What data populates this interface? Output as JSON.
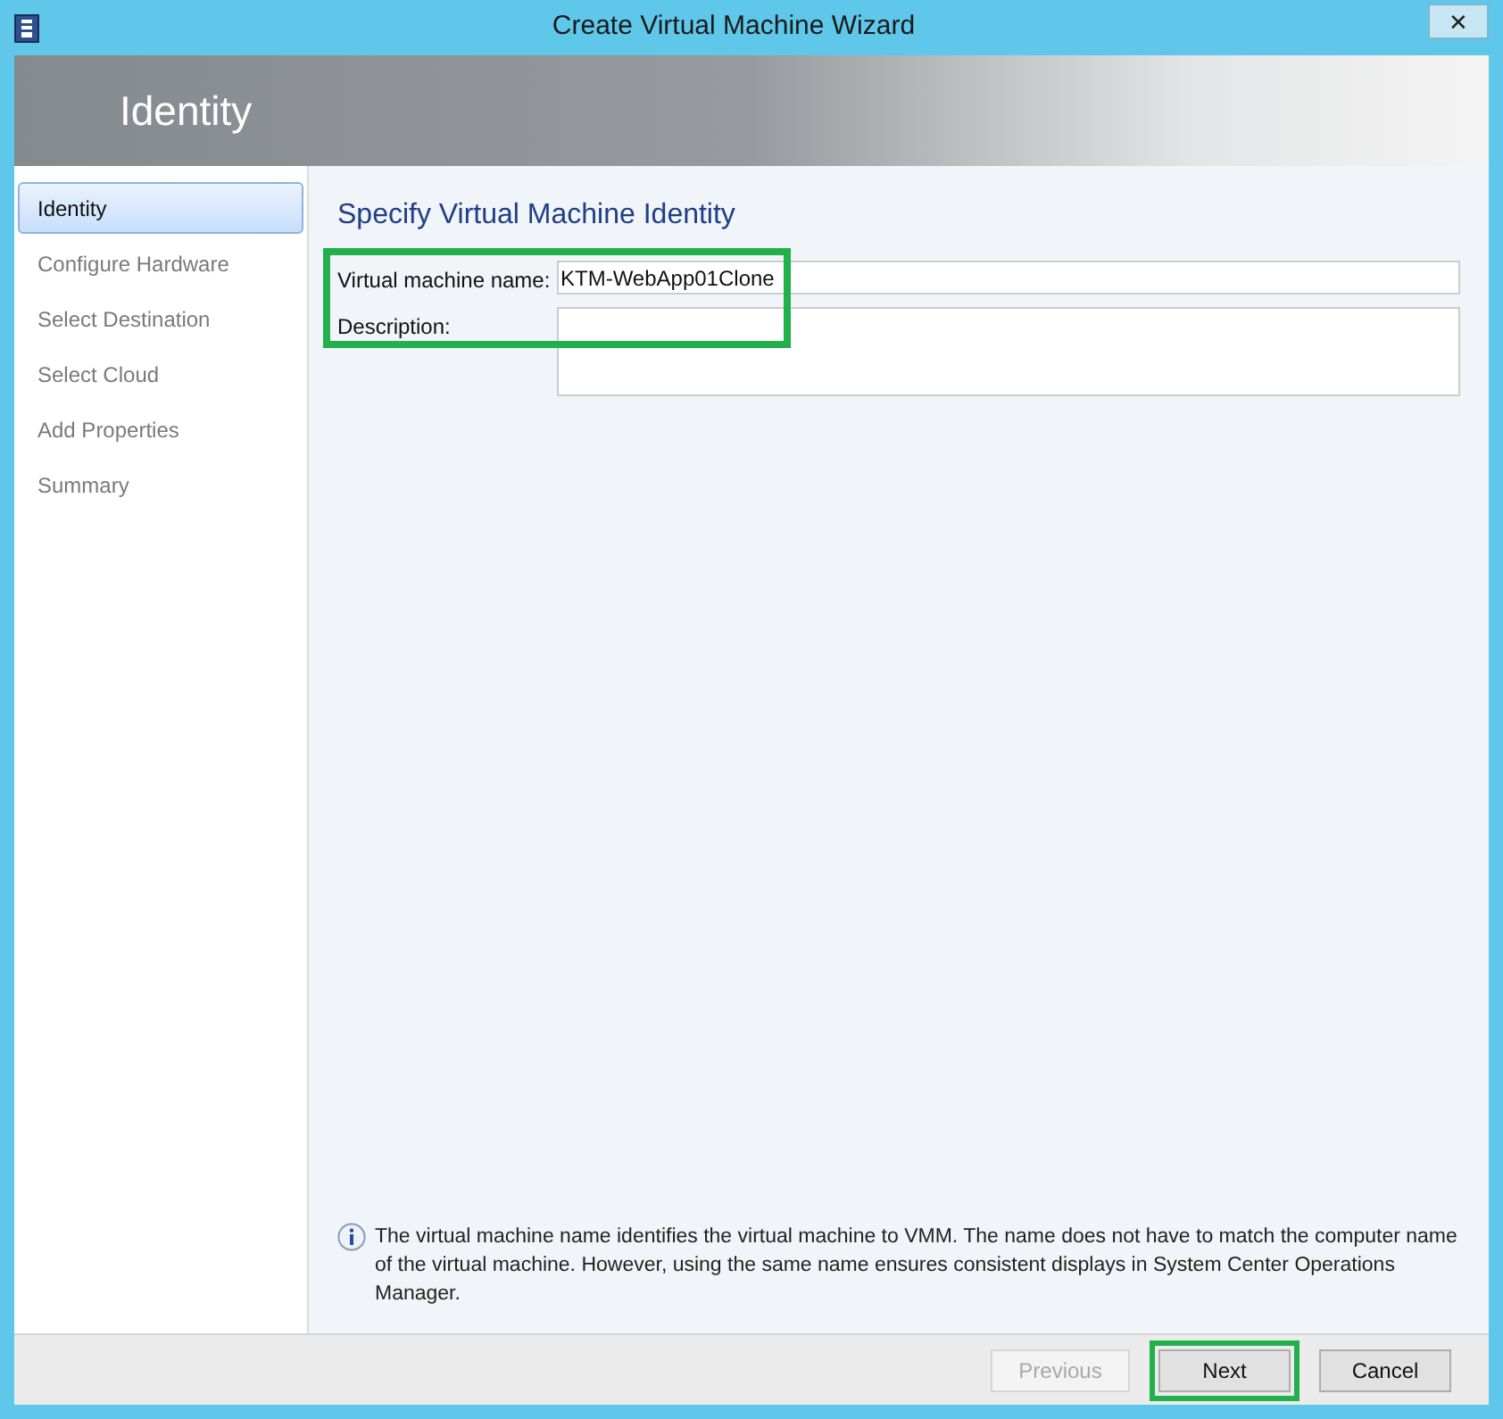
{
  "window": {
    "title": "Create Virtual Machine Wizard",
    "close": "✕"
  },
  "header": {
    "title": "Identity"
  },
  "sidebar": {
    "items": [
      {
        "label": "Identity",
        "selected": true
      },
      {
        "label": "Configure Hardware",
        "selected": false
      },
      {
        "label": "Select Destination",
        "selected": false
      },
      {
        "label": "Select Cloud",
        "selected": false
      },
      {
        "label": "Add Properties",
        "selected": false
      },
      {
        "label": "Summary",
        "selected": false
      }
    ]
  },
  "page": {
    "heading": "Specify Virtual Machine Identity",
    "highlighted": true,
    "fields": [
      {
        "kind": "text",
        "label": "Virtual machine name:",
        "value": "KTM-WebApp01Clone"
      },
      {
        "kind": "multiline",
        "label": "Description:"
      }
    ]
  },
  "info": {
    "text": "The virtual machine name identifies the virtual machine to VMM. The name does not have to match the computer name of the virtual machine. However, using the same name ensures consistent displays in System Center Operations Manager."
  },
  "buttons": [
    {
      "label": "Previous",
      "disabled": true,
      "highlighted": false
    },
    {
      "label": "Next",
      "disabled": false,
      "highlighted": true
    },
    {
      "label": "Cancel",
      "disabled": false,
      "highlighted": false
    }
  ]
}
